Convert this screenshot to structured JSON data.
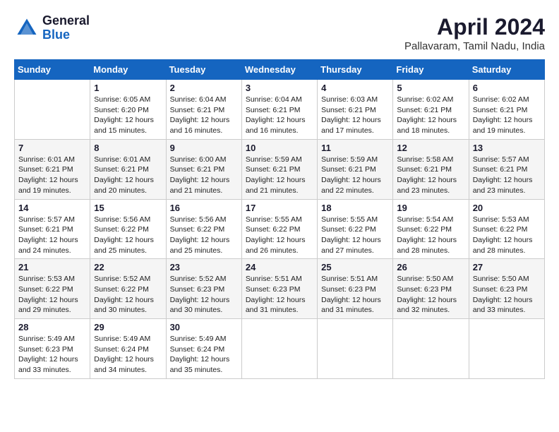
{
  "logo": {
    "line1": "General",
    "line2": "Blue"
  },
  "title": "April 2024",
  "subtitle": "Pallavaram, Tamil Nadu, India",
  "days_header": [
    "Sunday",
    "Monday",
    "Tuesday",
    "Wednesday",
    "Thursday",
    "Friday",
    "Saturday"
  ],
  "weeks": [
    [
      {
        "day": "",
        "info": ""
      },
      {
        "day": "1",
        "info": "Sunrise: 6:05 AM\nSunset: 6:20 PM\nDaylight: 12 hours\nand 15 minutes."
      },
      {
        "day": "2",
        "info": "Sunrise: 6:04 AM\nSunset: 6:21 PM\nDaylight: 12 hours\nand 16 minutes."
      },
      {
        "day": "3",
        "info": "Sunrise: 6:04 AM\nSunset: 6:21 PM\nDaylight: 12 hours\nand 16 minutes."
      },
      {
        "day": "4",
        "info": "Sunrise: 6:03 AM\nSunset: 6:21 PM\nDaylight: 12 hours\nand 17 minutes."
      },
      {
        "day": "5",
        "info": "Sunrise: 6:02 AM\nSunset: 6:21 PM\nDaylight: 12 hours\nand 18 minutes."
      },
      {
        "day": "6",
        "info": "Sunrise: 6:02 AM\nSunset: 6:21 PM\nDaylight: 12 hours\nand 19 minutes."
      }
    ],
    [
      {
        "day": "7",
        "info": "Sunrise: 6:01 AM\nSunset: 6:21 PM\nDaylight: 12 hours\nand 19 minutes."
      },
      {
        "day": "8",
        "info": "Sunrise: 6:01 AM\nSunset: 6:21 PM\nDaylight: 12 hours\nand 20 minutes."
      },
      {
        "day": "9",
        "info": "Sunrise: 6:00 AM\nSunset: 6:21 PM\nDaylight: 12 hours\nand 21 minutes."
      },
      {
        "day": "10",
        "info": "Sunrise: 5:59 AM\nSunset: 6:21 PM\nDaylight: 12 hours\nand 21 minutes."
      },
      {
        "day": "11",
        "info": "Sunrise: 5:59 AM\nSunset: 6:21 PM\nDaylight: 12 hours\nand 22 minutes."
      },
      {
        "day": "12",
        "info": "Sunrise: 5:58 AM\nSunset: 6:21 PM\nDaylight: 12 hours\nand 23 minutes."
      },
      {
        "day": "13",
        "info": "Sunrise: 5:57 AM\nSunset: 6:21 PM\nDaylight: 12 hours\nand 23 minutes."
      }
    ],
    [
      {
        "day": "14",
        "info": "Sunrise: 5:57 AM\nSunset: 6:21 PM\nDaylight: 12 hours\nand 24 minutes."
      },
      {
        "day": "15",
        "info": "Sunrise: 5:56 AM\nSunset: 6:22 PM\nDaylight: 12 hours\nand 25 minutes."
      },
      {
        "day": "16",
        "info": "Sunrise: 5:56 AM\nSunset: 6:22 PM\nDaylight: 12 hours\nand 25 minutes."
      },
      {
        "day": "17",
        "info": "Sunrise: 5:55 AM\nSunset: 6:22 PM\nDaylight: 12 hours\nand 26 minutes."
      },
      {
        "day": "18",
        "info": "Sunrise: 5:55 AM\nSunset: 6:22 PM\nDaylight: 12 hours\nand 27 minutes."
      },
      {
        "day": "19",
        "info": "Sunrise: 5:54 AM\nSunset: 6:22 PM\nDaylight: 12 hours\nand 28 minutes."
      },
      {
        "day": "20",
        "info": "Sunrise: 5:53 AM\nSunset: 6:22 PM\nDaylight: 12 hours\nand 28 minutes."
      }
    ],
    [
      {
        "day": "21",
        "info": "Sunrise: 5:53 AM\nSunset: 6:22 PM\nDaylight: 12 hours\nand 29 minutes."
      },
      {
        "day": "22",
        "info": "Sunrise: 5:52 AM\nSunset: 6:22 PM\nDaylight: 12 hours\nand 30 minutes."
      },
      {
        "day": "23",
        "info": "Sunrise: 5:52 AM\nSunset: 6:23 PM\nDaylight: 12 hours\nand 30 minutes."
      },
      {
        "day": "24",
        "info": "Sunrise: 5:51 AM\nSunset: 6:23 PM\nDaylight: 12 hours\nand 31 minutes."
      },
      {
        "day": "25",
        "info": "Sunrise: 5:51 AM\nSunset: 6:23 PM\nDaylight: 12 hours\nand 31 minutes."
      },
      {
        "day": "26",
        "info": "Sunrise: 5:50 AM\nSunset: 6:23 PM\nDaylight: 12 hours\nand 32 minutes."
      },
      {
        "day": "27",
        "info": "Sunrise: 5:50 AM\nSunset: 6:23 PM\nDaylight: 12 hours\nand 33 minutes."
      }
    ],
    [
      {
        "day": "28",
        "info": "Sunrise: 5:49 AM\nSunset: 6:23 PM\nDaylight: 12 hours\nand 33 minutes."
      },
      {
        "day": "29",
        "info": "Sunrise: 5:49 AM\nSunset: 6:24 PM\nDaylight: 12 hours\nand 34 minutes."
      },
      {
        "day": "30",
        "info": "Sunrise: 5:49 AM\nSunset: 6:24 PM\nDaylight: 12 hours\nand 35 minutes."
      },
      {
        "day": "",
        "info": ""
      },
      {
        "day": "",
        "info": ""
      },
      {
        "day": "",
        "info": ""
      },
      {
        "day": "",
        "info": ""
      }
    ]
  ]
}
